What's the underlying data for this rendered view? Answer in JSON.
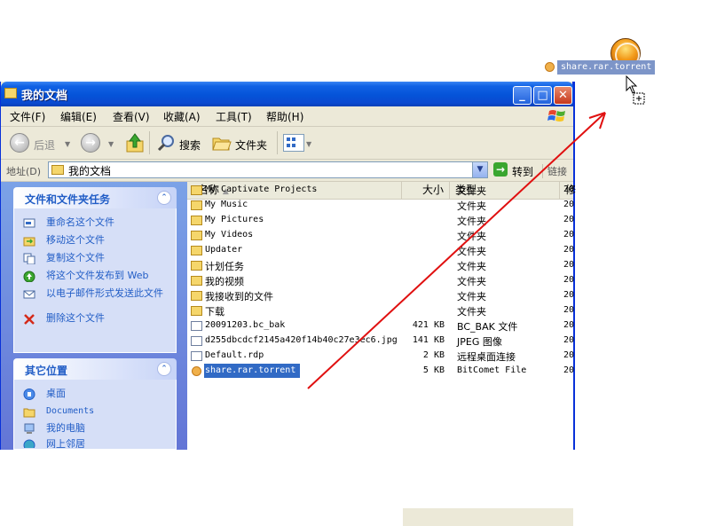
{
  "drag": {
    "label": "share.rar.torrent"
  },
  "window": {
    "title": "我的文档",
    "controls": {
      "minimize": "_",
      "maximize": "□",
      "close": "✕"
    }
  },
  "menu": [
    "文件(F)",
    "编辑(E)",
    "查看(V)",
    "收藏(A)",
    "工具(T)",
    "帮助(H)"
  ],
  "toolbar": {
    "back": "后退",
    "search": "搜索",
    "folders": "文件夹"
  },
  "address": {
    "label": "地址(D)",
    "value": "我的文档",
    "go": "转到",
    "links": "链接"
  },
  "tasks_panel": {
    "title": "文件和文件夹任务",
    "items": [
      "重命名这个文件",
      "移动这个文件",
      "复制这个文件",
      "将这个文件发布到 Web",
      "以电子邮件形式发送此文件",
      "删除这个文件"
    ]
  },
  "places_panel": {
    "title": "其它位置",
    "items": [
      "桌面",
      "Documents",
      "我的电脑",
      "网上邻居"
    ]
  },
  "columns": {
    "name": "名称",
    "size": "大小",
    "type": "类型",
    "date": "修"
  },
  "files": [
    {
      "name": "My Captivate Projects",
      "size": "",
      "type": "文件夹",
      "date": "20",
      "kind": "folder"
    },
    {
      "name": "My Music",
      "size": "",
      "type": "文件夹",
      "date": "20",
      "kind": "folder"
    },
    {
      "name": "My Pictures",
      "size": "",
      "type": "文件夹",
      "date": "20",
      "kind": "folder"
    },
    {
      "name": "My Videos",
      "size": "",
      "type": "文件夹",
      "date": "20",
      "kind": "folder"
    },
    {
      "name": "Updater",
      "size": "",
      "type": "文件夹",
      "date": "20",
      "kind": "folder"
    },
    {
      "name": "计划任务",
      "size": "",
      "type": "文件夹",
      "date": "20",
      "kind": "folder"
    },
    {
      "name": "我的视频",
      "size": "",
      "type": "文件夹",
      "date": "20",
      "kind": "folder"
    },
    {
      "name": "我接收到的文件",
      "size": "",
      "type": "文件夹",
      "date": "20",
      "kind": "folder"
    },
    {
      "name": "下载",
      "size": "",
      "type": "文件夹",
      "date": "20",
      "kind": "folder"
    },
    {
      "name": "20091203.bc_bak",
      "size": "421 KB",
      "type": "BC_BAK 文件",
      "date": "20",
      "kind": "file"
    },
    {
      "name": "d255dbcdcf2145a420f14b40c27e3ec6.jpg",
      "size": "141 KB",
      "type": "JPEG 图像",
      "date": "20",
      "kind": "file"
    },
    {
      "name": "Default.rdp",
      "size": "2 KB",
      "type": "远程桌面连接",
      "date": "20",
      "kind": "file"
    },
    {
      "name": "share.rar.torrent",
      "size": "5 KB",
      "type": "BitComet File",
      "date": "20",
      "kind": "torrent",
      "selected": true
    }
  ],
  "colors": {
    "xp_blue": "#0553d8",
    "task_link": "#215dc6",
    "selection": "#316ac5",
    "annotation_arrow": "#e01010"
  }
}
